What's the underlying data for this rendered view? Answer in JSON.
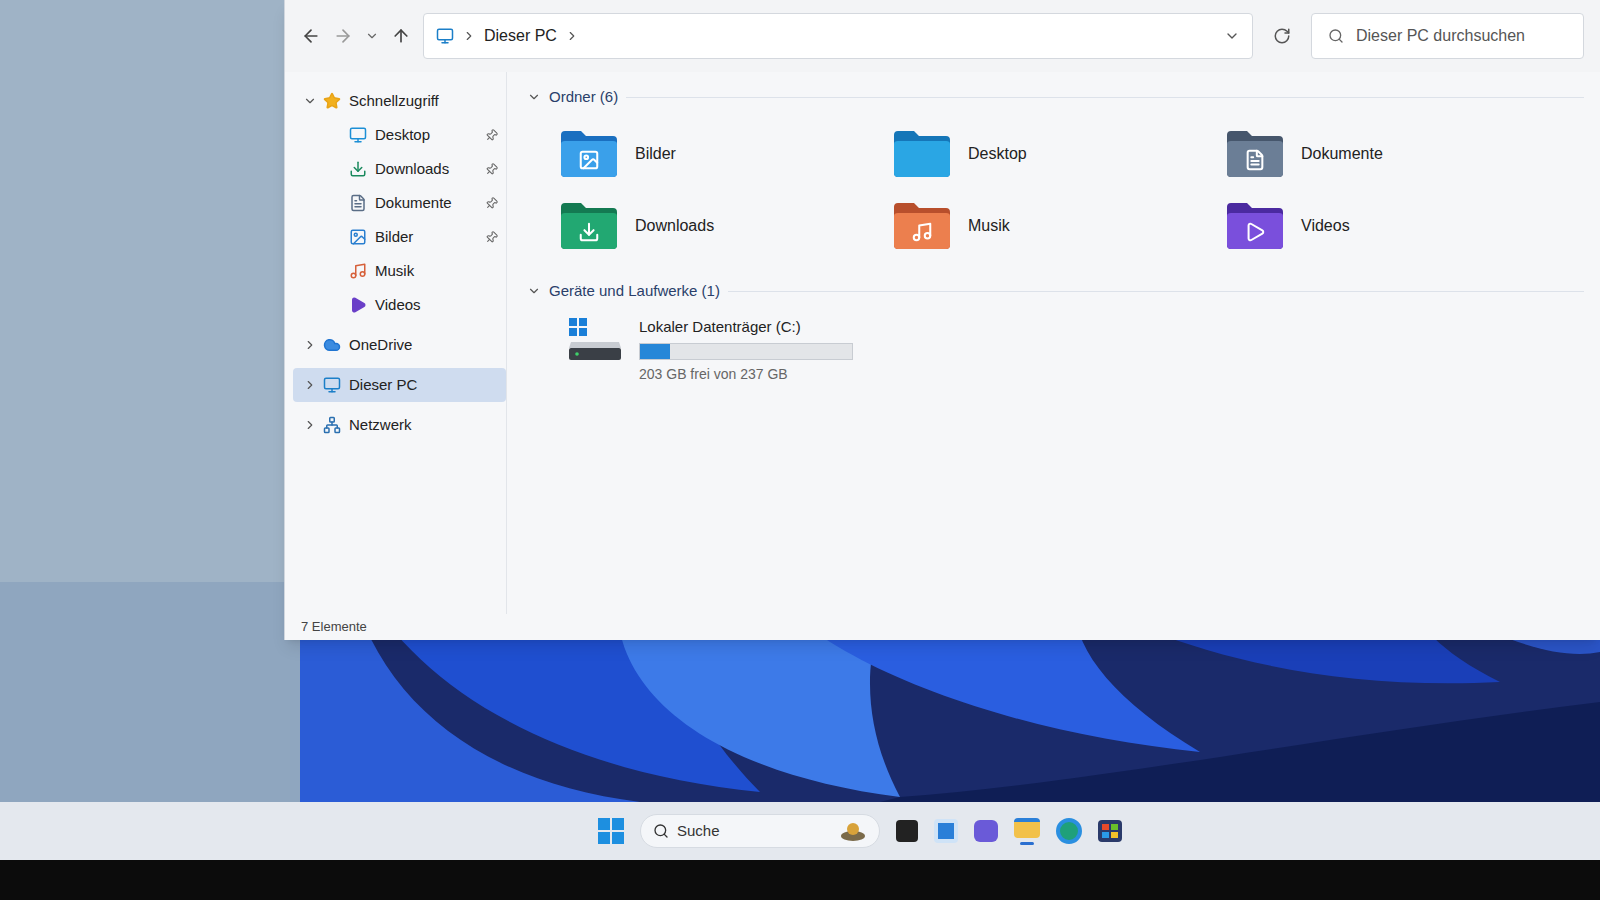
{
  "window": {
    "address": "Dieser PC",
    "search_placeholder": "Dieser PC durchsuchen"
  },
  "sidebar": {
    "items": [
      {
        "label": "Schnellzugriff",
        "kind": "star",
        "level": 0,
        "expandable": true,
        "expanded": true,
        "pinned": false,
        "selected": false
      },
      {
        "label": "Desktop",
        "kind": "desktop",
        "level": 1,
        "expandable": false,
        "expanded": false,
        "pinned": true,
        "selected": false
      },
      {
        "label": "Downloads",
        "kind": "downloads",
        "level": 1,
        "expandable": false,
        "expanded": false,
        "pinned": true,
        "selected": false
      },
      {
        "label": "Dokumente",
        "kind": "documents",
        "level": 1,
        "expandable": false,
        "expanded": false,
        "pinned": true,
        "selected": false
      },
      {
        "label": "Bilder",
        "kind": "pictures",
        "level": 1,
        "expandable": false,
        "expanded": false,
        "pinned": true,
        "selected": false
      },
      {
        "label": "Musik",
        "kind": "music",
        "level": 1,
        "expandable": false,
        "expanded": false,
        "pinned": false,
        "selected": false
      },
      {
        "label": "Videos",
        "kind": "videos",
        "level": 1,
        "expandable": false,
        "expanded": false,
        "pinned": false,
        "selected": false
      },
      {
        "label": "OneDrive",
        "kind": "cloud",
        "level": 0,
        "expandable": true,
        "expanded": false,
        "pinned": false,
        "selected": false
      },
      {
        "label": "Dieser PC",
        "kind": "pc",
        "level": 0,
        "expandable": true,
        "expanded": false,
        "pinned": false,
        "selected": true
      },
      {
        "label": "Netzwerk",
        "kind": "network",
        "level": 0,
        "expandable": true,
        "expanded": false,
        "pinned": false,
        "selected": false
      }
    ]
  },
  "folders_section": {
    "title": "Ordner (6)",
    "expanded": true,
    "items": [
      {
        "label": "Bilder",
        "kind": "pictures"
      },
      {
        "label": "Desktop",
        "kind": "desktop"
      },
      {
        "label": "Dokumente",
        "kind": "documents"
      },
      {
        "label": "Downloads",
        "kind": "downloads"
      },
      {
        "label": "Musik",
        "kind": "music"
      },
      {
        "label": "Videos",
        "kind": "videos"
      }
    ]
  },
  "drives_section": {
    "title": "Geräte und Laufwerke (1)",
    "expanded": true,
    "items": [
      {
        "label": "Lokaler Datenträger (C:)",
        "free_text": "203 GB frei von 237 GB",
        "level": 0.14
      }
    ]
  },
  "status_bar": "7 Elemente",
  "taskbar": {
    "search_placeholder": "Suche"
  }
}
